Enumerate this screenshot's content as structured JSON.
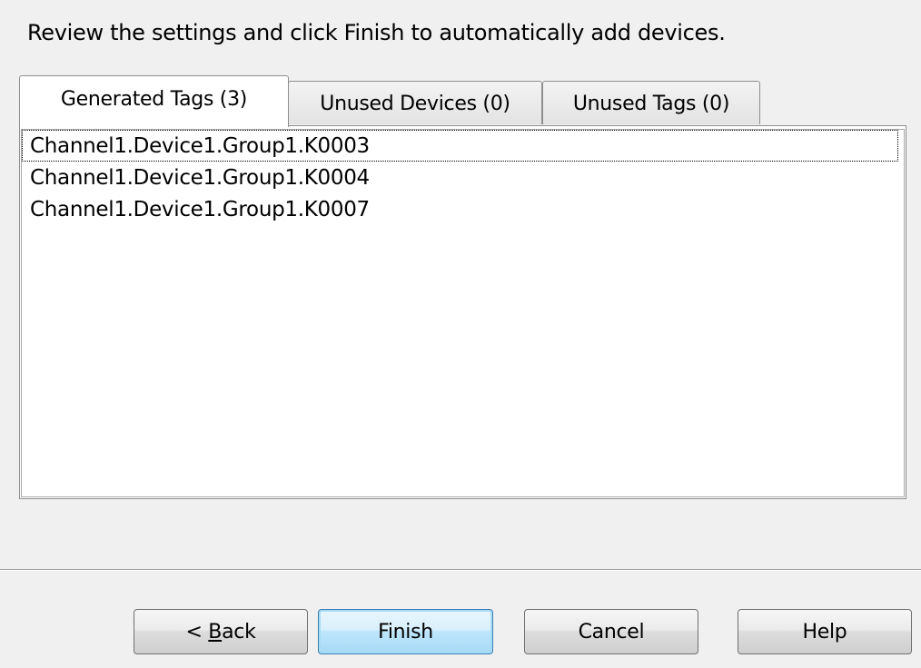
{
  "instruction": "Review the settings and click Finish to automatically add devices.",
  "tabs": [
    {
      "label": "Generated Tags (3)",
      "active": true
    },
    {
      "label": "Unused Devices (0)",
      "active": false
    },
    {
      "label": "Unused Tags (0)",
      "active": false
    }
  ],
  "generated_tags": [
    "Channel1.Device1.Group1.K0003",
    "Channel1.Device1.Group1.K0004",
    "Channel1.Device1.Group1.K0007"
  ],
  "buttons": {
    "back": {
      "prefix": "< ",
      "mnemonic": "B",
      "rest": "ack"
    },
    "finish": "Finish",
    "cancel": "Cancel",
    "help": "Help"
  },
  "colors": {
    "dialog_background": "#f0f0f0",
    "default_button_border": "#3c7fb1",
    "default_button_fill": "#bee6fd"
  }
}
